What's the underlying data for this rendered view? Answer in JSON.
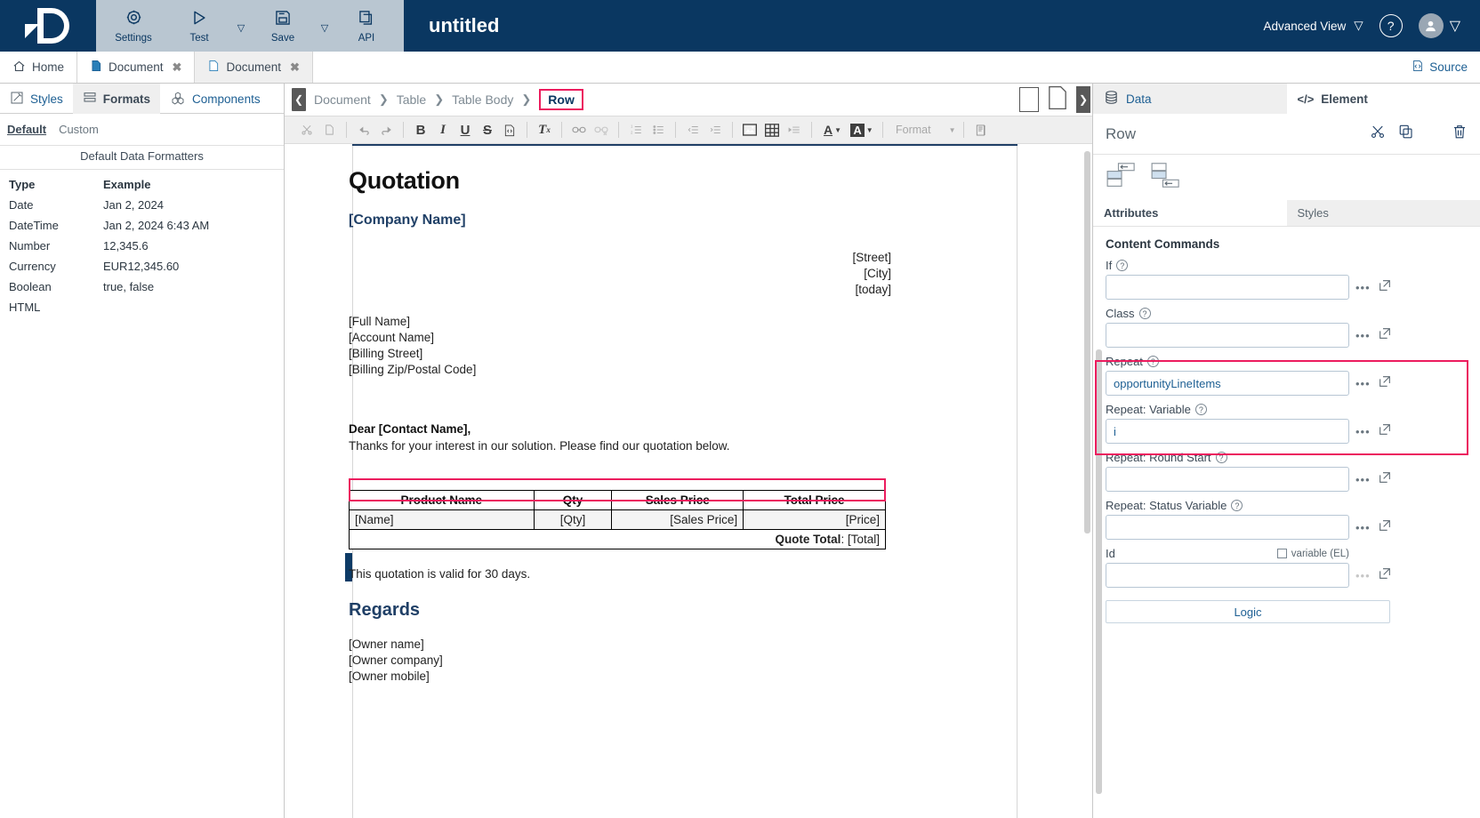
{
  "topbar": {
    "logo_name": "logo-d",
    "ribbon": [
      {
        "icon": "gear-icon",
        "label": "Settings",
        "caret": false
      },
      {
        "icon": "play-icon",
        "label": "Test",
        "caret": true
      },
      {
        "icon": "save-icon",
        "label": "Save",
        "caret": true
      },
      {
        "icon": "api-icon",
        "label": "API",
        "caret": false
      }
    ],
    "document_title": "untitled",
    "advanced_view": "Advanced View",
    "help": "?",
    "caret_glyph": "▽"
  },
  "tabbar": {
    "tabs": [
      {
        "label": "Home",
        "icon": "home-icon",
        "closable": false,
        "active": false
      },
      {
        "label": "Document",
        "icon": "document-filled-icon",
        "closable": true,
        "active": false
      },
      {
        "label": "Document",
        "icon": "document-outline-icon",
        "closable": true,
        "active": true
      }
    ],
    "close_glyph": "✖",
    "source_label": "Source"
  },
  "left_panel": {
    "tabs": [
      {
        "label": "Styles",
        "icon": "pencil-icon",
        "active": false
      },
      {
        "label": "Formats",
        "icon": "formats-icon",
        "active": true
      },
      {
        "label": "Components",
        "icon": "components-icon",
        "active": false
      }
    ],
    "subtabs": [
      {
        "label": "Default",
        "active": true
      },
      {
        "label": "Custom",
        "active": false
      }
    ],
    "section_title": "Default Data Formatters",
    "table": {
      "headers": [
        "Type",
        "Example"
      ],
      "rows": [
        [
          "Date",
          "Jan 2, 2024"
        ],
        [
          "DateTime",
          "Jan 2, 2024 6:43 AM"
        ],
        [
          "Number",
          "12,345.6"
        ],
        [
          "Currency",
          "EUR12,345.60"
        ],
        [
          "Boolean",
          "true, false"
        ],
        [
          "HTML",
          ""
        ]
      ]
    }
  },
  "breadcrumb": {
    "items": [
      "Document",
      "Table",
      "Table Body"
    ],
    "active": "Row",
    "separator": "❯",
    "collapse_left_glyph": "❮",
    "collapse_right_glyph": "❯"
  },
  "editor_toolbar": {
    "format_label": "Format",
    "items": [
      "cut-icon",
      "copy-icon",
      "undo-icon",
      "redo-icon",
      "bold-icon",
      "italic-icon",
      "underline-icon",
      "strikethrough-icon",
      "source-code-icon",
      "remove-format-icon",
      "link-icon",
      "unlink-icon",
      "numbered-list-icon",
      "bulleted-list-icon",
      "outdent-icon",
      "indent-icon",
      "image-icon",
      "table-icon",
      "page-break-icon",
      "text-color-icon",
      "background-color-icon",
      "reveal-icon"
    ]
  },
  "document": {
    "title": "Quotation",
    "company": "[Company Name]",
    "right_block": [
      "[Street]",
      "[City]",
      "[today]"
    ],
    "address_block": [
      "[Full Name]",
      "[Account Name]",
      "[Billing Street]",
      "[Billing Zip/Postal Code]"
    ],
    "salutation": "Dear [Contact Name],",
    "intro": "Thanks for your interest in our solution. Please find our quotation below.",
    "table": {
      "headers": [
        "Product Name",
        "Qty",
        "Sales Price",
        "Total Price"
      ],
      "rows": [
        [
          "[Name]",
          "[Qty]",
          "[Sales Price]",
          "[Price]"
        ]
      ],
      "total_label": "Quote Total",
      "total_sep": ":",
      "total_value": "[Total]"
    },
    "validity": "This quotation is valid for 30 days.",
    "regards": "Regards",
    "owner_block": [
      "[Owner name]",
      "[Owner company]",
      "[Owner mobile]"
    ]
  },
  "right_panel": {
    "tabs": [
      {
        "label": "Data",
        "icon": "database-icon",
        "active": false
      },
      {
        "label": "Element",
        "icon": "code-icon",
        "active": true
      }
    ],
    "element_name": "Row",
    "header_icons": [
      "scissors-icon",
      "copy-icon",
      "trash-icon"
    ],
    "action_icons": [
      "insert-before-icon",
      "insert-after-icon"
    ],
    "subtabs": [
      {
        "label": "Attributes",
        "active": true
      },
      {
        "label": "Styles",
        "active": false
      }
    ],
    "section_title": "Content Commands",
    "fields": [
      {
        "label": "If",
        "value": "",
        "help": true,
        "dots": true
      },
      {
        "label": "Class",
        "value": "",
        "help": true,
        "dots": true
      },
      {
        "label": "Repeat",
        "value": "opportunityLineItems",
        "help": true,
        "dots": true
      },
      {
        "label": "Repeat: Variable",
        "value": "i",
        "help": true,
        "dots": true
      },
      {
        "label": "Repeat: Round Start",
        "value": "",
        "help": true,
        "dots": true
      },
      {
        "label": "Repeat: Status Variable",
        "value": "",
        "help": true,
        "dots": true
      },
      {
        "label": "Id",
        "value": "",
        "help": false,
        "dots": true,
        "variable_label": "variable (EL)"
      }
    ],
    "logic_button": "Logic",
    "help_glyph": "?"
  },
  "colors": {
    "brand_navy": "#0a3761",
    "ribbon_gray": "#b9c6d1",
    "accent_pink": "#ec1c5e",
    "link_blue": "#1d5f93",
    "heading_blue": "#1f3f66"
  }
}
